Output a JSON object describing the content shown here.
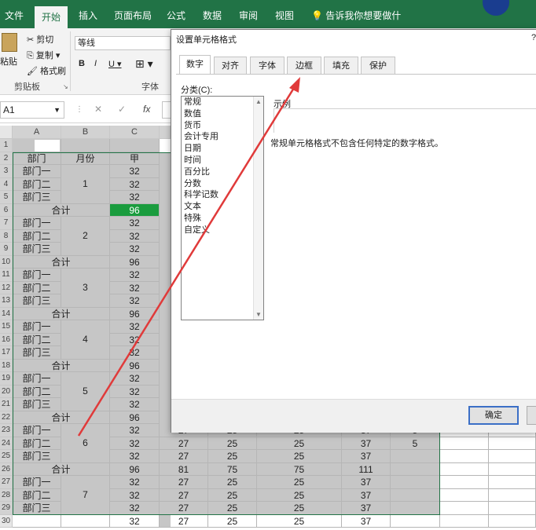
{
  "ribbon": {
    "tabs": [
      "文件",
      "开始",
      "插入",
      "页面布局",
      "公式",
      "数据",
      "审阅",
      "视图"
    ],
    "tell_me": "告诉我你想要做什么",
    "clipboard": {
      "paste": "粘贴",
      "cut": "剪切",
      "copy": "复制",
      "format_painter": "格式刷",
      "group_label": "剪贴板"
    },
    "font": {
      "name": "等线",
      "bold": "B",
      "italic": "I",
      "underline": "U",
      "group_label": "字体"
    }
  },
  "formula_bar": {
    "name_box": "A1",
    "cancel": "✕",
    "enter": "✓",
    "fx": "fx"
  },
  "sheet": {
    "columns": [
      "A",
      "B",
      "C"
    ],
    "rows": [
      "1",
      "2",
      "3",
      "4",
      "5",
      "6",
      "7",
      "8",
      "9",
      "10",
      "11",
      "12",
      "13",
      "14",
      "15",
      "16",
      "17",
      "18",
      "19",
      "20",
      "21",
      "22",
      "23",
      "24",
      "25",
      "26",
      "27",
      "28",
      "29",
      "30"
    ],
    "header_row": {
      "dept": "部门",
      "month": "月份",
      "col_c": "甲"
    },
    "dept_names": [
      "部门一",
      "部门二",
      "部门三"
    ],
    "subtotal": "合计",
    "months": [
      "1",
      "2",
      "3",
      "4",
      "5",
      "6",
      "7"
    ],
    "c_values": [
      "32",
      "32",
      "32",
      "96",
      "32",
      "32",
      "32",
      "96",
      "32",
      "32",
      "32",
      "96",
      "32",
      "32",
      "32",
      "96",
      "32",
      "32",
      "32",
      "96",
      "32",
      "32",
      "32",
      "96",
      "32",
      "32",
      "32",
      "32"
    ],
    "right_rows": [
      [
        "27",
        "25",
        "25",
        "37",
        "5"
      ],
      [
        "27",
        "25",
        "25",
        "37",
        ""
      ],
      [
        "81",
        "75",
        "75",
        "111",
        ""
      ],
      [
        "27",
        "25",
        "25",
        "37",
        ""
      ],
      [
        "27",
        "25",
        "25",
        "37",
        ""
      ],
      [
        "27",
        "25",
        "25",
        "37",
        ""
      ],
      [
        "27",
        "25",
        "25",
        "37",
        ""
      ]
    ],
    "row23_partial": [
      "27",
      "25",
      "25",
      "37",
      "5"
    ]
  },
  "dialog": {
    "title": "设置单元格格式",
    "help": "?",
    "tabs": [
      "数字",
      "对齐",
      "字体",
      "边框",
      "填充",
      "保护"
    ],
    "category_label": "分类(C):",
    "categories": [
      "常规",
      "数值",
      "货币",
      "会计专用",
      "日期",
      "时间",
      "百分比",
      "分数",
      "科学记数",
      "文本",
      "特殊",
      "自定义"
    ],
    "sample_label": "示例",
    "description": "常规单元格格式不包含任何特定的数字格式。",
    "ok": "确定"
  },
  "colors": {
    "excel_green": "#217346",
    "arrow": "#e03a3a",
    "selection": "#c6c6c6",
    "fill_green": "#1a9c3e"
  }
}
